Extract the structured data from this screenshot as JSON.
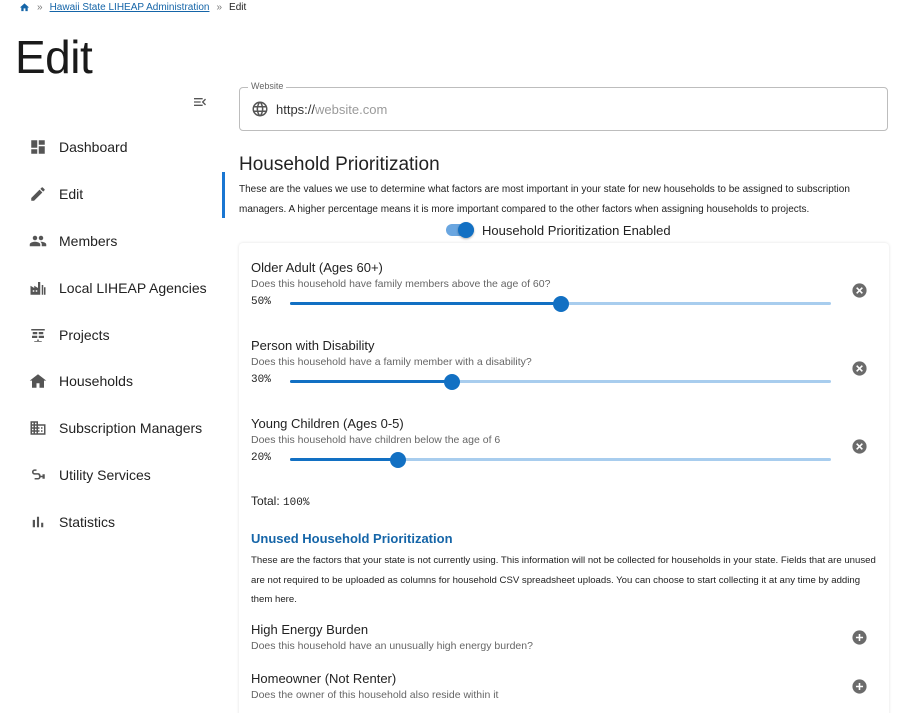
{
  "breadcrumb": {
    "parent": "Hawaii State LIHEAP Administration",
    "current": "Edit",
    "separator": "»"
  },
  "page": {
    "title": "Edit"
  },
  "sidebar": {
    "items": [
      {
        "label": "Dashboard",
        "icon": "dashboard-icon"
      },
      {
        "label": "Edit",
        "icon": "pencil-icon"
      },
      {
        "label": "Members",
        "icon": "people-icon"
      },
      {
        "label": "Local LIHEAP Agencies",
        "icon": "factory-icon"
      },
      {
        "label": "Projects",
        "icon": "solar-panel-icon"
      },
      {
        "label": "Households",
        "icon": "house-icon"
      },
      {
        "label": "Subscription Managers",
        "icon": "building-icon"
      },
      {
        "label": "Utility Services",
        "icon": "plug-icon"
      },
      {
        "label": "Statistics",
        "icon": "bar-chart-icon"
      }
    ],
    "active": "Edit"
  },
  "website": {
    "label": "Website",
    "prefix": "https://",
    "placeholder": "website.com",
    "value": ""
  },
  "prioritization": {
    "title": "Household Prioritization",
    "description": "These are the values we use to determine what factors are most important in your state for new households to be assigned to subscription managers. A higher percentage means it is more important compared to the other factors when assigning households to projects.",
    "toggle_label": "Household Prioritization Enabled",
    "enabled": true,
    "factors": [
      {
        "title": "Older Adult (Ages 60+)",
        "question": "Does this household have family members above the age of 60?",
        "percent_label": "50%",
        "value": 0.5
      },
      {
        "title": "Person with Disability",
        "question": "Does this household have a family member with a disability?",
        "percent_label": "30%",
        "value": 0.3
      },
      {
        "title": "Young Children (Ages 0-5)",
        "question": "Does this household have children below the age of 6",
        "percent_label": "20%",
        "value": 0.2
      }
    ],
    "total_label": "Total:",
    "total_value": "100%"
  },
  "unused": {
    "title": "Unused Household Prioritization",
    "description": "These are the factors that your state is not currently using. This information will not be collected for households in your state. Fields that are unused are not required to be uploaded as columns for household CSV spreadsheet uploads. You can choose to start collecting it at any time by adding them here.",
    "factors": [
      {
        "title": "High Energy Burden",
        "question": "Does this household have an unusually high energy burden?"
      },
      {
        "title": "Homeowner (Not Renter)",
        "question": "Does the owner of this household also reside within it"
      }
    ]
  },
  "colors": {
    "accent": "#1270c3",
    "link": "#1565a8",
    "track": "#a8cdee"
  }
}
